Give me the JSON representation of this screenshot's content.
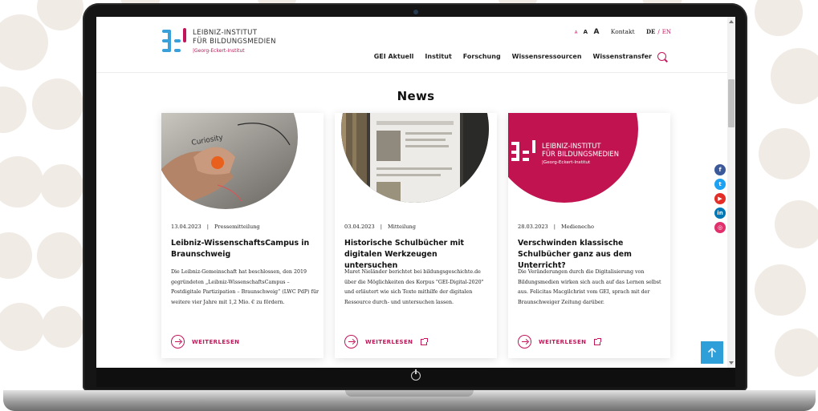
{
  "logo": {
    "line1": "LEIBNIZ-INSTITUT",
    "line2": "FÜR BILDUNGSMEDIEN",
    "subline": "|Georg-Eckert-Institut"
  },
  "utility": {
    "font_small": "A",
    "font_medium": "A",
    "font_large": "A",
    "contact": "Kontakt",
    "lang_de": "DE",
    "lang_sep": "/",
    "lang_en": "EN"
  },
  "nav": [
    "GEI Aktuell",
    "Institut",
    "Forschung",
    "Wissensressourcen",
    "Wissenstransfer"
  ],
  "news": {
    "title": "News",
    "cards": [
      {
        "date": "13.04.2023",
        "sep": "|",
        "category": "Pressemitteilung",
        "title": "Leibniz-WissenschaftsCampus in Braunschweig",
        "text": "Die Leibniz-Gemeinschaft hat beschlossen, den 2019 gegründeten „Leibniz-WissenschaftsCampus – Postdigitale Partizipation – Braunschweig“ (LWC PdP) für weitere vier Jahre mit 1,2 Mio. € zu fördern.",
        "link": "WEITERLESEN"
      },
      {
        "date": "03.04.2023",
        "sep": "|",
        "category": "Mitteilung",
        "title": "Historische Schulbücher mit digitalen Werkzeugen untersuchen",
        "text": "Maret Nieländer berichtet bei bildungsgeschichte.de über die Möglichkeiten des Korpus \"GEI-Digital-2020\" und erläutert wie sich Texte mithilfe der digitalen Ressource durch- und untersuchen lassen.",
        "link": "WEITERLESEN"
      },
      {
        "date": "28.03.2023",
        "sep": "|",
        "category": "Medienecho",
        "title": "Verschwinden klassische Schulbücher ganz aus dem Unterricht?",
        "text": "Die Veränderungen durch die Digitalisierung von Bildungsmedien wirken sich auch auf das Lernen selbst aus. Felicitas Macgilchrist vom GEI, sprach mit der Braunschweiger Zeitung darüber.",
        "link": "WEITERLESEN",
        "image_logo_line1": "LEIBNIZ-INSTITUT",
        "image_logo_line2": "FÜR BILDUNGSMEDIEN",
        "image_logo_sub": "|Georg-Eckert-Institut"
      }
    ]
  },
  "social": [
    {
      "icon": "facebook-icon",
      "glyph": "f",
      "color": "#3b5998"
    },
    {
      "icon": "twitter-icon",
      "glyph": "t",
      "color": "#1da1f2"
    },
    {
      "icon": "youtube-icon",
      "glyph": "▶",
      "color": "#e52d27"
    },
    {
      "icon": "linkedin-icon",
      "glyph": "in",
      "color": "#0077b5"
    },
    {
      "icon": "instagram-icon",
      "glyph": "◎",
      "color": "#e1306c"
    }
  ],
  "colors": {
    "accent": "#c3155a",
    "brand_blue": "#3aa0da",
    "to_top": "#2f9fd9"
  }
}
